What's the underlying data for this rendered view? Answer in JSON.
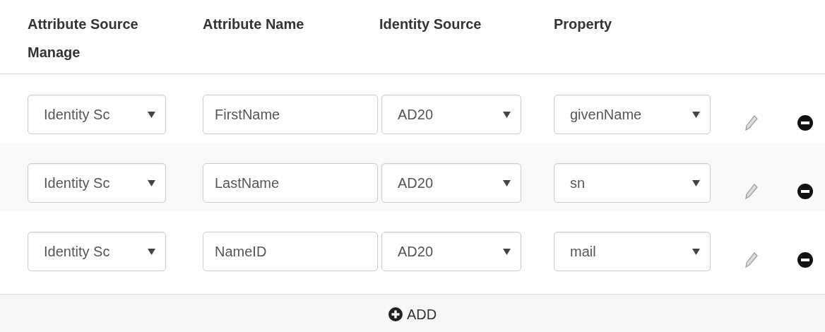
{
  "columns": [
    {
      "label": "Attribute Source Manage"
    },
    {
      "label": "Attribute Name"
    },
    {
      "label": "Identity Source"
    },
    {
      "label": "Property"
    }
  ],
  "rows": [
    {
      "source": "Identity Sc",
      "attribute_name": "FirstName",
      "identity_source": "AD20",
      "property": "givenName"
    },
    {
      "source": "Identity Sc",
      "attribute_name": "LastName",
      "identity_source": "AD20",
      "property": "sn"
    },
    {
      "source": "Identity Sc",
      "attribute_name": "NameID",
      "identity_source": "AD20",
      "property": "mail"
    }
  ],
  "add_button": {
    "label": "ADD"
  }
}
